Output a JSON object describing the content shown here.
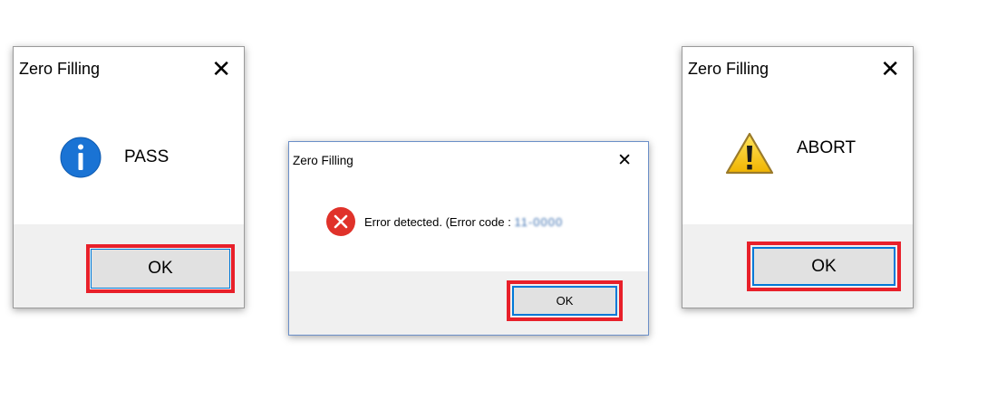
{
  "dialogs": [
    {
      "title": "Zero Filling",
      "close_glyph": "✕",
      "icon": "info-icon",
      "message": "PASS",
      "ok_label": "OK"
    },
    {
      "title": "Zero Filling",
      "close_glyph": "✕",
      "icon": "error-icon",
      "message": "Error detected. (Error code : ",
      "error_code": "11-0000",
      "ok_label": "OK"
    },
    {
      "title": "Zero Filling",
      "close_glyph": "✕",
      "icon": "warning-icon",
      "message": "ABORT",
      "ok_label": "OK"
    }
  ],
  "colors": {
    "highlight": "#e8202a",
    "button_focus_border": "#0078d7",
    "footer_bg": "#f0f0f0",
    "info_blue": "#1a73d4",
    "error_red": "#e0322a",
    "warning_yellow": "#f5c400"
  }
}
